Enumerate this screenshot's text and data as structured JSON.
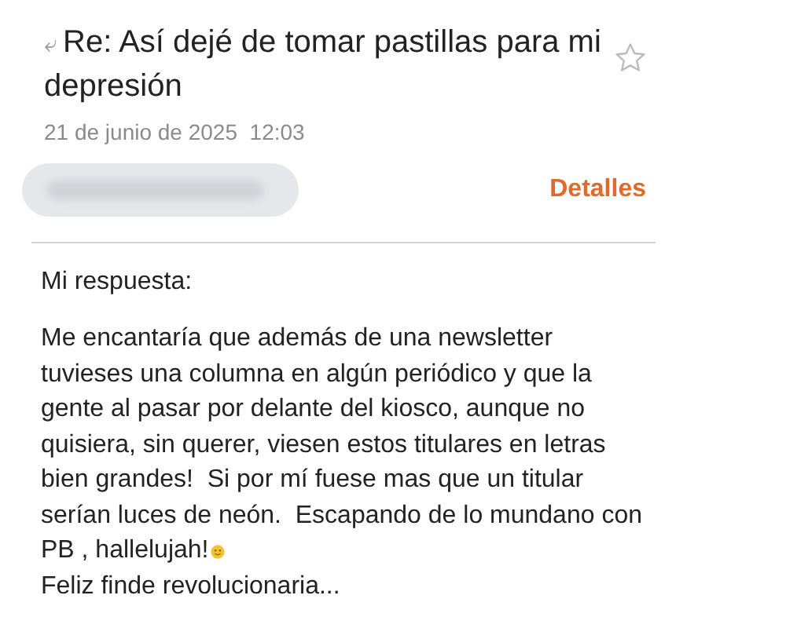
{
  "message": {
    "reply_icon": "⤶",
    "subject": "Re: Así dejé de tomar pastillas para mi depresión",
    "starred": false,
    "date": "21 de junio de 2025",
    "time": "12:03",
    "details_link": "Detalles"
  },
  "body": {
    "intro": "Mi respuesta:",
    "lines": [
      "Me encantaría que además de una newsletter",
      "tuvieses una columna en algún periódico y que la",
      "gente al pasar por delante del kiosco, aunque no",
      "quisiera, sin querer, viesen estos titulares en letras",
      "bien grandes!  Si por mí fuese mas que un titular",
      "serían luces de neón.  Escapando de lo mundano con",
      "PB , hallelujah!"
    ],
    "closing": "Feliz finde revolucionaria..."
  }
}
